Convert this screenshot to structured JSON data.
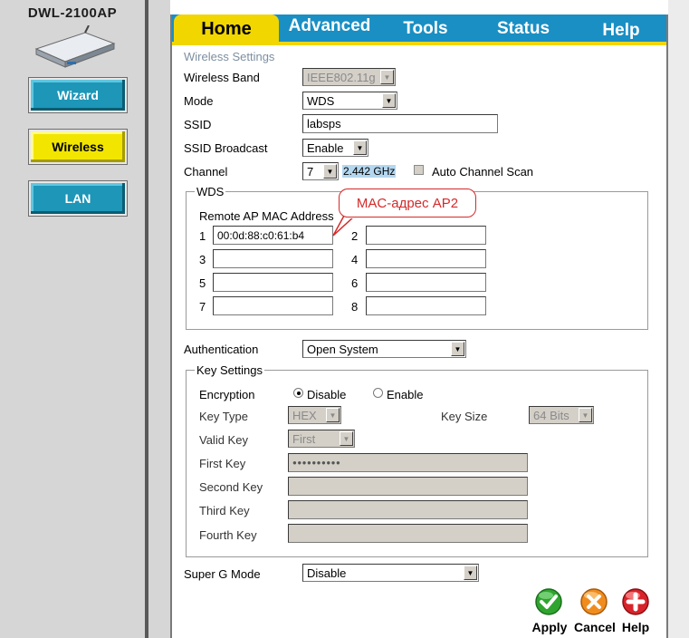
{
  "product": {
    "title": "DWL-2100AP"
  },
  "nav": [
    {
      "label": "Wizard",
      "active": false
    },
    {
      "label": "Wireless",
      "active": true
    },
    {
      "label": "LAN",
      "active": false
    }
  ],
  "tabs": [
    "Home",
    "Advanced",
    "Tools",
    "Status",
    "Help"
  ],
  "section_title": "Wireless Settings",
  "form": {
    "wireless_band": {
      "label": "Wireless Band",
      "value": "IEEE802.11g"
    },
    "mode": {
      "label": "Mode",
      "value": "WDS"
    },
    "ssid": {
      "label": "SSID",
      "value": "labsps"
    },
    "ssid_broadcast": {
      "label": "SSID Broadcast",
      "value": "Enable"
    },
    "channel": {
      "label": "Channel",
      "value": "7",
      "frequency": "2.442 GHz",
      "auto_scan_label": "Auto Channel Scan"
    },
    "authentication": {
      "label": "Authentication",
      "value": "Open System"
    },
    "super_g": {
      "label": "Super G Mode",
      "value": "Disable"
    }
  },
  "wds": {
    "legend": "WDS",
    "remote_label": "Remote AP MAC Address",
    "entries": [
      {
        "num": "1",
        "value": "00:0d:88:c0:61:b4"
      },
      {
        "num": "2",
        "value": ""
      },
      {
        "num": "3",
        "value": ""
      },
      {
        "num": "4",
        "value": ""
      },
      {
        "num": "5",
        "value": ""
      },
      {
        "num": "6",
        "value": ""
      },
      {
        "num": "7",
        "value": ""
      },
      {
        "num": "8",
        "value": ""
      }
    ],
    "callout": "MAC-адрес AP2"
  },
  "key_settings": {
    "legend": "Key Settings",
    "encryption_label": "Encryption",
    "encryption_options": [
      "Disable",
      "Enable"
    ],
    "encryption_selected": "Disable",
    "key_type_label": "Key Type",
    "key_type_value": "HEX",
    "key_size_label": "Key Size",
    "key_size_value": "64 Bits",
    "valid_key_label": "Valid Key",
    "valid_key_value": "First",
    "first_key_label": "First Key",
    "first_key_value": "●●●●●●●●●●",
    "second_key_label": "Second Key",
    "third_key_label": "Third Key",
    "fourth_key_label": "Fourth Key"
  },
  "actions": {
    "apply": "Apply",
    "cancel": "Cancel",
    "help": "Help"
  },
  "colors": {
    "tab_blue": "#1a8fc4",
    "tab_active": "#f2d600",
    "apply": "#2fa52f",
    "cancel": "#f08c1e",
    "help": "#d8232a",
    "callout": "#d42a2a"
  }
}
